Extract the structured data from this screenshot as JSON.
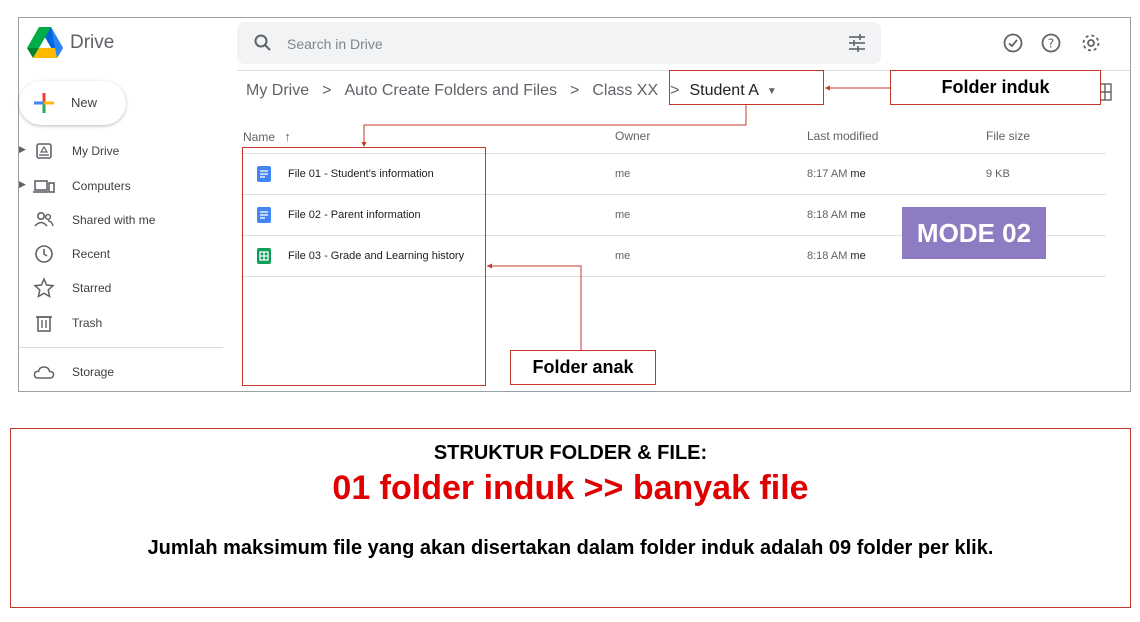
{
  "app": {
    "name": "Drive"
  },
  "search": {
    "placeholder": "Search in Drive"
  },
  "new_button": {
    "label": "New"
  },
  "sidebar": {
    "items": [
      {
        "label": "My Drive",
        "icon": "my-drive-icon",
        "expandable": true
      },
      {
        "label": "Computers",
        "icon": "computers-icon",
        "expandable": true
      },
      {
        "label": "Shared with me",
        "icon": "shared-with-me-icon",
        "expandable": false
      },
      {
        "label": "Recent",
        "icon": "clock-icon",
        "expandable": false
      },
      {
        "label": "Starred",
        "icon": "star-icon",
        "expandable": false
      },
      {
        "label": "Trash",
        "icon": "trash-icon",
        "expandable": false
      }
    ],
    "storage": {
      "label": "Storage",
      "icon": "cloud-icon"
    }
  },
  "breadcrumb": {
    "items": [
      "My Drive",
      "Auto Create Folders and Files",
      "Class XX",
      "Student A"
    ],
    "separator": ">"
  },
  "table": {
    "columns": {
      "name": "Name",
      "owner": "Owner",
      "modified": "Last modified",
      "size": "File size"
    },
    "rows": [
      {
        "name": "File 01 - Student's information",
        "type": "docs",
        "owner": "me",
        "modified_time": "8:17 AM",
        "modified_by": "me",
        "size": "9 KB"
      },
      {
        "name": "File 02 - Parent information",
        "type": "docs",
        "owner": "me",
        "modified_time": "8:18 AM",
        "modified_by": "me",
        "size": ""
      },
      {
        "name": "File 03 - Grade and Learning history",
        "type": "sheets",
        "owner": "me",
        "modified_time": "8:18 AM",
        "modified_by": "me",
        "size": ""
      }
    ]
  },
  "annotations": {
    "parent_label": "Folder induk",
    "child_label": "Folder anak",
    "mode_label": "MODE 02",
    "color": "#c0392b",
    "mode_color": "#8e7cc3"
  },
  "panel": {
    "heading": "STRUKTUR FOLDER & FILE:",
    "title": "01 folder induk >> banyak file",
    "description": "Jumlah maksimum file yang akan disertakan dalam folder induk adalah 09 folder per klik."
  },
  "colors": {
    "docs": "#4285f4",
    "sheets": "#0f9d58",
    "title_red": "#e00000"
  }
}
